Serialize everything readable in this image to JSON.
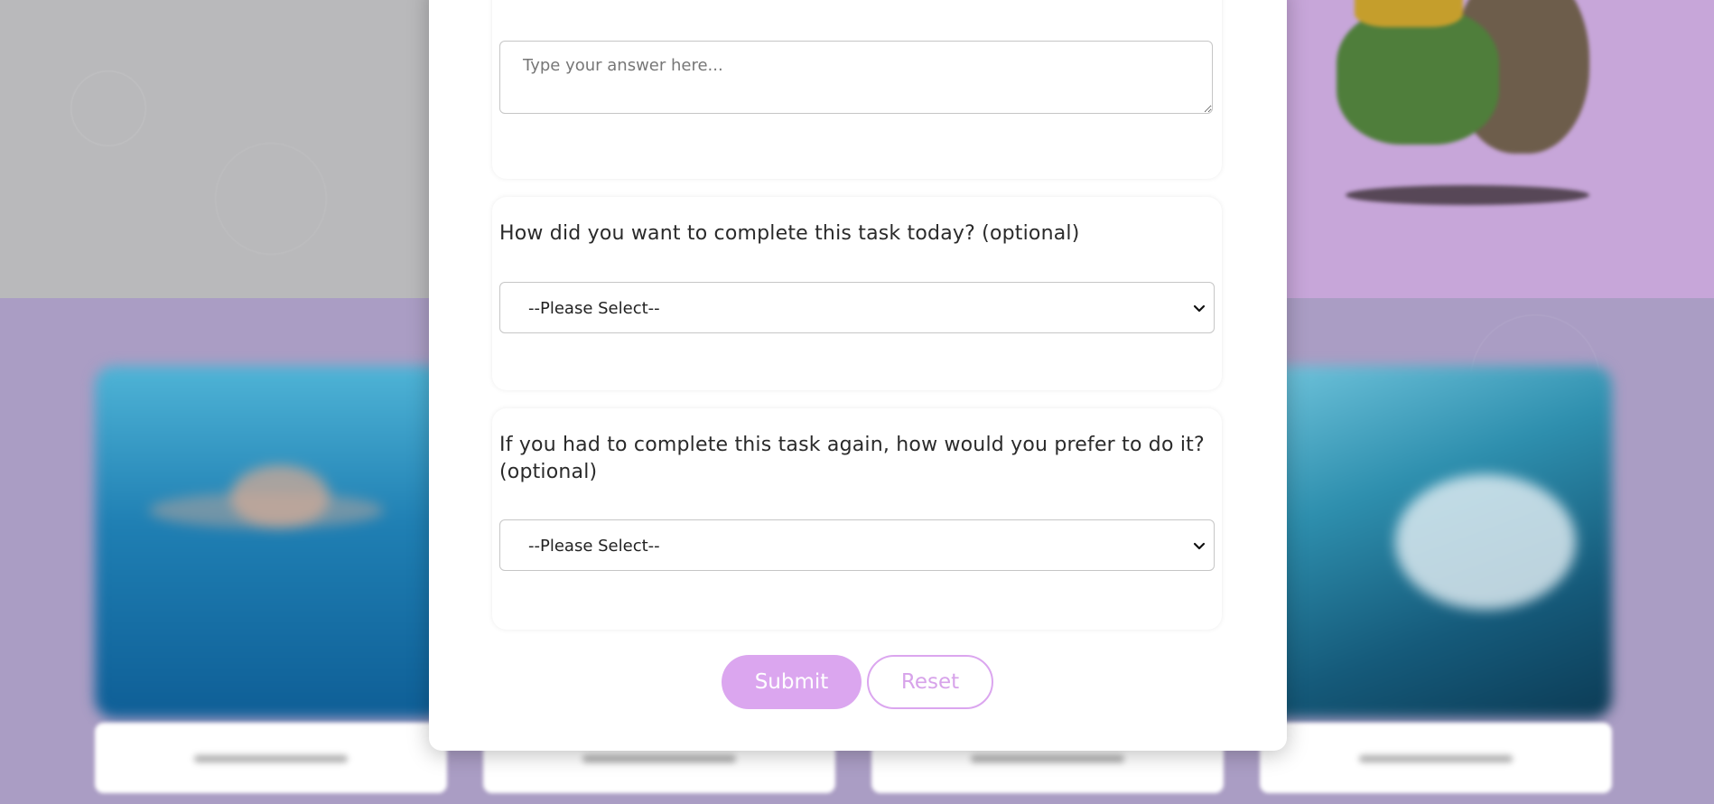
{
  "background": {
    "tiles": [
      {
        "name": "swimmer-image"
      },
      {
        "name": "water-image"
      },
      {
        "name": "ocean-image"
      },
      {
        "name": "surf-wave-image"
      }
    ]
  },
  "form": {
    "question_1": {
      "answer_placeholder": "Type your answer here..."
    },
    "question_2": {
      "label": "How did you want to complete this task today? (optional)",
      "selected_value": "--Please Select--"
    },
    "question_3": {
      "label": "If you had to complete this task again, how would you prefer to do it? (optional)",
      "selected_value": "--Please Select--"
    },
    "submit_label": "Submit",
    "reset_label": "Reset"
  },
  "colors": {
    "accent": "#dba6ef",
    "accent_text": "#d7a3ea",
    "modal_bg": "#ffffff"
  }
}
